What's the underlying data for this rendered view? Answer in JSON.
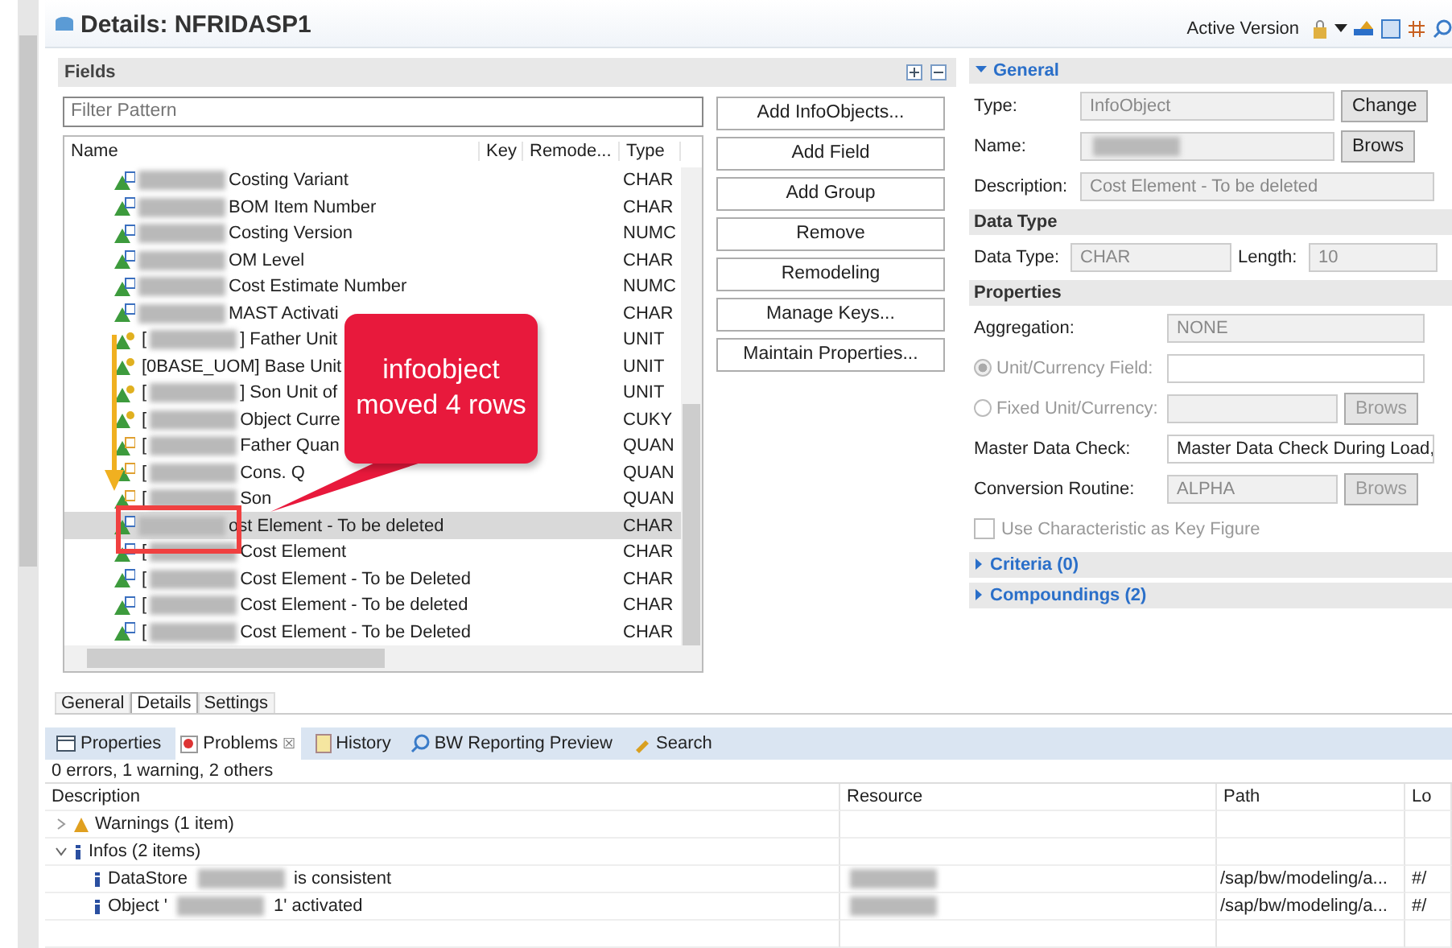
{
  "editor": {
    "title": "Details: NFRIDASP1",
    "version_label": "Active Version"
  },
  "fields": {
    "title": "Fields",
    "filter": {
      "placeholder": "Filter Pattern"
    },
    "columns": [
      "Name",
      "Key",
      "Remode...",
      "Type"
    ],
    "rows": [
      {
        "kind": "char",
        "prefix": "",
        "redacted": true,
        "name": "Costing Variant",
        "type": "CHAR",
        "selected": false
      },
      {
        "kind": "char",
        "prefix": "",
        "redacted": true,
        "name": "BOM Item Number",
        "type": "CHAR",
        "selected": false
      },
      {
        "kind": "char",
        "prefix": "",
        "redacted": true,
        "name": "Costing Version",
        "type": "NUMC",
        "selected": false
      },
      {
        "kind": "char",
        "prefix": "",
        "redacted": true,
        "name": "OM Level",
        "type": "CHAR",
        "selected": false
      },
      {
        "kind": "char",
        "prefix": "",
        "redacted": true,
        "name": "Cost Estimate Number",
        "type": "NUMC",
        "selected": false
      },
      {
        "kind": "char",
        "prefix": "",
        "redacted": true,
        "name": "MAST Activati",
        "type": "CHAR",
        "selected": false
      },
      {
        "kind": "unit",
        "prefix": "[",
        "redacted": true,
        "name": "] Father Unit",
        "type": "UNIT",
        "selected": false
      },
      {
        "kind": "unit",
        "prefix": "",
        "redacted": false,
        "name": "[0BASE_UOM] Base Unit",
        "type": "UNIT",
        "selected": false
      },
      {
        "kind": "unit",
        "prefix": "[",
        "redacted": true,
        "name": "] Son Unit of",
        "type": "UNIT",
        "selected": false
      },
      {
        "kind": "unit",
        "prefix": "[",
        "redacted": true,
        "name": "Object Curre",
        "type": "CUKY",
        "selected": false
      },
      {
        "kind": "quan",
        "prefix": "[",
        "redacted": true,
        "name": "Father Quan",
        "type": "QUAN",
        "selected": false
      },
      {
        "kind": "quan",
        "prefix": "[",
        "redacted": true,
        "name": "Cons. Q",
        "type": "QUAN",
        "selected": false
      },
      {
        "kind": "quan",
        "prefix": "[",
        "redacted": true,
        "name": "Son",
        "type": "QUAN",
        "selected": false
      },
      {
        "kind": "char",
        "prefix": "",
        "redacted": true,
        "name": "ost Element - To be deleted",
        "type": "CHAR",
        "selected": true
      },
      {
        "kind": "char",
        "prefix": "[",
        "redacted": true,
        "name": "Cost Element",
        "type": "CHAR",
        "selected": false
      },
      {
        "kind": "char",
        "prefix": "[",
        "redacted": true,
        "name": "Cost Element - To be Deleted",
        "type": "CHAR",
        "selected": false
      },
      {
        "kind": "char",
        "prefix": "[",
        "redacted": true,
        "name": "Cost Element - To be deleted",
        "type": "CHAR",
        "selected": false
      },
      {
        "kind": "char",
        "prefix": "[",
        "redacted": true,
        "name": "Cost Element - To be Deleted",
        "type": "CHAR",
        "selected": false
      }
    ],
    "buttons": [
      "Add InfoObjects...",
      "Add Field",
      "Add Group",
      "Remove",
      "Remodeling",
      "Manage Keys...",
      "Maintain Properties..."
    ]
  },
  "callout": {
    "text": "infoobject moved 4 rows"
  },
  "general": {
    "title": "General",
    "type_label": "Type:",
    "type_value": "InfoObject",
    "change_button": "Change",
    "name_label": "Name:",
    "browse_button": "Brows",
    "description_label": "Description:",
    "description_value": "Cost Element - To be deleted",
    "data_type_title": "Data Type",
    "data_type_label": "Data Type:",
    "data_type_value": "CHAR",
    "length_label": "Length:",
    "length_value": "10",
    "properties_title": "Properties",
    "aggregation_label": "Aggregation:",
    "aggregation_value": "NONE",
    "unit_field": {
      "label": "Unit/Currency Field:",
      "selected": true
    },
    "fixed_unit": {
      "label": "Fixed Unit/Currency:",
      "selected": false
    },
    "fixed_browse": "Brows",
    "master_check_label": "Master Data Check:",
    "master_check_value": "Master Data Check During Load,",
    "conversion_label": "Conversion Routine:",
    "conversion_value": "ALPHA",
    "conversion_browse": "Brows",
    "key_figure": {
      "label": "Use Characteristic as Key Figure",
      "checked": false
    },
    "sections": [
      {
        "label": "Criteria (0)",
        "expanded": false
      },
      {
        "label": "Compoundings (2)",
        "expanded": false
      }
    ]
  },
  "editor_tabs": [
    {
      "label": "General",
      "selected": false
    },
    {
      "label": "Details",
      "selected": true
    },
    {
      "label": "Settings",
      "selected": false
    }
  ],
  "views": [
    {
      "label": "Properties",
      "kind": "properties",
      "selected": false
    },
    {
      "label": "Problems",
      "kind": "problems",
      "selected": true,
      "close": "☒"
    },
    {
      "label": "History",
      "kind": "history",
      "selected": false
    },
    {
      "label": "BW Reporting Preview",
      "kind": "preview",
      "selected": false
    },
    {
      "label": "Search",
      "kind": "search",
      "selected": false
    }
  ],
  "problems": {
    "summary": "0 errors, 1 warning, 2 others",
    "columns": [
      "Description",
      "Resource",
      "Path",
      "Lo"
    ],
    "groups": [
      {
        "kind": "warning",
        "label": "Warnings (1 item)",
        "expanded": false
      },
      {
        "kind": "info",
        "label": "Infos (2 items)",
        "expanded": true,
        "children": [
          {
            "before": "DataStore",
            "after": "is consistent",
            "path": "/sap/bw/modeling/a...",
            "location": "#/"
          },
          {
            "before": "Object '",
            "after": "1' activated",
            "path": "/sap/bw/modeling/a...",
            "location": "#/"
          }
        ]
      }
    ]
  }
}
